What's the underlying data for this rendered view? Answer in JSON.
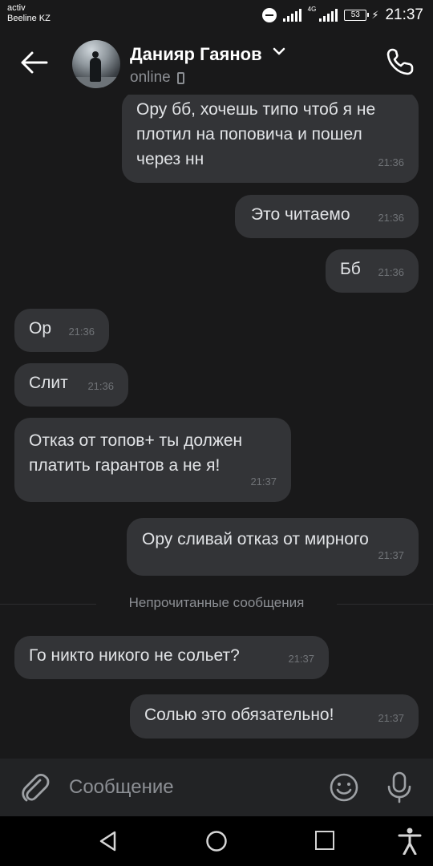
{
  "status_bar": {
    "carrier_line1": "activ",
    "carrier_line2": "Beeline KZ",
    "network_type": "4G",
    "battery": "53",
    "time": "21:37"
  },
  "header": {
    "contact_name": "Данияр Гаянов",
    "status": "online",
    "icons": [
      "back-arrow-icon",
      "chevron-down-icon",
      "mobile-device-icon",
      "phone-call-icon"
    ]
  },
  "messages": [
    {
      "direction": "outgoing",
      "text": "Ору бб, хочешь типо чтоб я не плотил на поповича и пошел через нн",
      "time": "21:36"
    },
    {
      "direction": "outgoing",
      "text": "Это читаемо",
      "time": "21:36"
    },
    {
      "direction": "outgoing",
      "text": "Бб",
      "time": "21:36"
    },
    {
      "direction": "incoming",
      "text": "Ор",
      "time": "21:36"
    },
    {
      "direction": "incoming",
      "text": "Слит",
      "time": "21:36"
    },
    {
      "direction": "incoming",
      "text": "Отказ от топов+ ты должен платить гарантов а не я!",
      "time": "21:37"
    },
    {
      "direction": "outgoing",
      "text": "Ору сливай отказ от мирного",
      "time": "21:37"
    },
    {
      "direction": "incoming",
      "text": "Го никто никого не сольет?",
      "time": "21:37"
    },
    {
      "direction": "outgoing",
      "text": "Солью это обязательно!",
      "time": "21:37"
    }
  ],
  "unread_divider": "Непрочитанные сообщения",
  "composer": {
    "placeholder": "Сообщение",
    "icons": [
      "paperclip-icon",
      "smiley-icon",
      "microphone-icon"
    ]
  },
  "nav_bar": {
    "icons": [
      "nav-back-icon",
      "nav-home-icon",
      "nav-recents-icon",
      "accessibility-icon"
    ]
  },
  "colors": {
    "background": "#19191a",
    "bubble": "#333437",
    "text": "#e1e3e6",
    "secondary_text": "#8c8f94"
  }
}
